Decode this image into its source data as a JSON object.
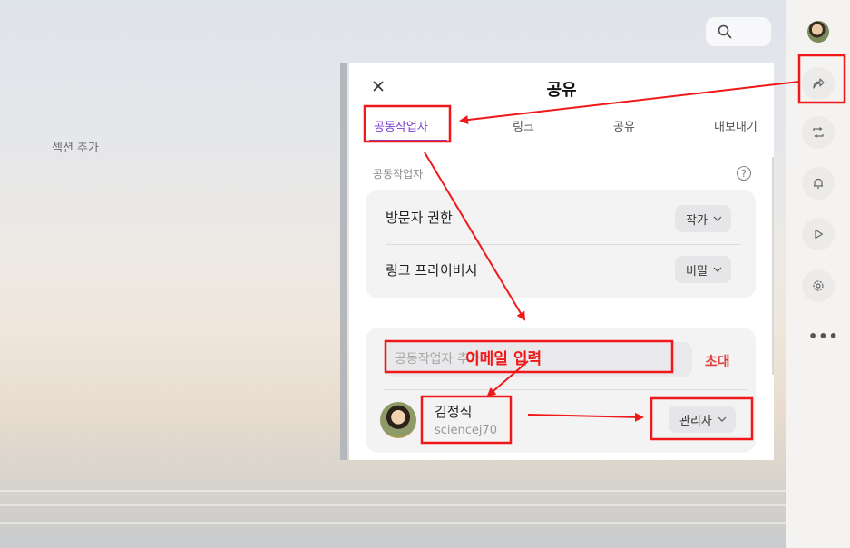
{
  "workspace": {
    "add_section": "섹션 추가"
  },
  "share_panel": {
    "title": "공유",
    "tabs": [
      {
        "label": "공동작업자",
        "active": true
      },
      {
        "label": "링크"
      },
      {
        "label": "공유"
      },
      {
        "label": "내보내기"
      }
    ],
    "section_label": "공동작업자",
    "settings": [
      {
        "label": "방문자 권한",
        "value": "작가"
      },
      {
        "label": "링크 프라이버시",
        "value": "비밀"
      }
    ],
    "invite": {
      "placeholder": "공동작업자 추가",
      "button": "초대"
    },
    "collaborator": {
      "name": "김정식",
      "username": "sciencej70",
      "role": "관리자"
    }
  },
  "sidebar": {
    "icons": [
      "avatar",
      "share-icon",
      "repost-icon",
      "bell-icon",
      "play-icon",
      "settings-icon",
      "more-icon"
    ]
  },
  "annotation": {
    "label": "이메일 입력",
    "color": "#f01818"
  },
  "colors": {
    "accent": "#7b3fd0",
    "invite": "#e0403f"
  }
}
